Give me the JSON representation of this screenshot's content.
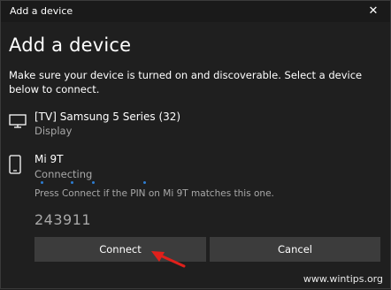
{
  "window": {
    "title": "Add a device",
    "close_glyph": "✕"
  },
  "heading": "Add a device",
  "instructions": "Make sure your device is turned on and discoverable. Select a device below to connect.",
  "devices": [
    {
      "name": "[TV] Samsung 5 Series (32)",
      "type": "Display",
      "icon": "monitor-icon"
    },
    {
      "name": "Mi 9T",
      "status": "Connecting",
      "icon": "phone-icon",
      "pin_message": "Press Connect if the PIN on Mi 9T matches this one.",
      "pin": "243911"
    }
  ],
  "buttons": {
    "connect": "Connect",
    "cancel": "Cancel"
  },
  "watermark": "www.wintips.org",
  "colors": {
    "background": "#1f1f1f",
    "button": "#3c3c3c",
    "secondary_text": "#a8a8a8",
    "progress_dots": "#2d7dd2",
    "annotation_arrow": "#e0201b"
  }
}
